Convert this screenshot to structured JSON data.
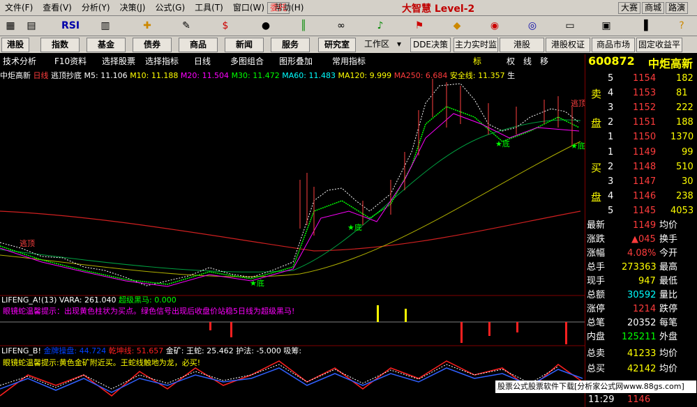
{
  "menu": {
    "items": [
      "文件(F)",
      "查看(V)",
      "分析(Y)",
      "决策(J)",
      "公式(G)",
      "工具(T)",
      "窗口(W)",
      "帮助(H)"
    ],
    "wt": "委托",
    "logo": "大智慧 Level-2",
    "dasai": "大赛",
    "shangcheng": "商城",
    "lubiao": "路演"
  },
  "toolbar": {
    "rsi": "RSI"
  },
  "nav": {
    "items": [
      "港股",
      "指数",
      "基金",
      "债券",
      "商品",
      "新闻",
      "服务",
      "研究室"
    ],
    "workzone": "工作区",
    "dde": "DDE决策",
    "tools": [
      "主力实时监",
      "港股",
      "港股权证",
      "商品市场",
      "固定收益平"
    ]
  },
  "subbar": {
    "items": [
      "技术分析",
      "F10资料",
      "选择股票",
      "选择指标",
      "日线",
      "多图组合",
      "图形叠加",
      "常用指标"
    ],
    "biao": "标",
    "quan": "权",
    "xian": "线",
    "yi": "移"
  },
  "info": {
    "stock_name": "中炬高新",
    "period": "日线",
    "indicator": "逃顶抄底",
    "ma5": "M5: 11.106",
    "ma10": "M10: 11.188",
    "ma20": "M20: 11.504",
    "ma30": "M30: 11.472",
    "ma60": "MA60: 11.483",
    "ma120": "MA120: 9.999",
    "ma250": "MA250: 6.684",
    "safe": "安全线: 11.357",
    "sheng": "生"
  },
  "chart_labels": {
    "taoding": "逃顶",
    "di": "底"
  },
  "ind1": {
    "name": "LIFENG_A!(13)",
    "vara": "VARA: 261.040",
    "chaoji": "超级黑马: 0.000",
    "tip": "眼镜蛇温馨提示：出现黄色柱状为买点。绿色信号出现后收盘价站稳5日线为超级黑马!"
  },
  "ind2": {
    "name": "LIFENG_B!",
    "jinshen": "金牌操盘:",
    "jinshen_val": "44.724",
    "qiankun": "乾坤线:",
    "qiankun_val": "51.657",
    "jinkuang": "金矿:",
    "wangshe": "王蛇:",
    "wangshe_val": "25.462",
    "hufa": "护法:",
    "hufa_val": "-5.000",
    "xichou": "吸筹:",
    "tip": "眼镜蛇温馨提示:黄色金矿附近买。王蛇线触地为龙，必买!"
  },
  "quote": {
    "code": "600872",
    "name": "中炬高新",
    "sell_label": [
      "卖",
      "盘"
    ],
    "buy_label": [
      "买",
      "盘"
    ],
    "sells": [
      {
        "lv": "5",
        "p": "1154",
        "v": "182"
      },
      {
        "lv": "4",
        "p": "1153",
        "v": "81"
      },
      {
        "lv": "3",
        "p": "1152",
        "v": "222"
      },
      {
        "lv": "2",
        "p": "1151",
        "v": "188"
      },
      {
        "lv": "1",
        "p": "1150",
        "v": "1370"
      }
    ],
    "buys": [
      {
        "lv": "1",
        "p": "1149",
        "v": "99"
      },
      {
        "lv": "2",
        "p": "1148",
        "v": "510"
      },
      {
        "lv": "3",
        "p": "1147",
        "v": "30"
      },
      {
        "lv": "4",
        "p": "1146",
        "v": "238"
      },
      {
        "lv": "5",
        "p": "1145",
        "v": "4053"
      }
    ],
    "stats": [
      {
        "l": "最新",
        "v": "1149",
        "r": "均价"
      },
      {
        "l": "涨跌",
        "v": "▲045",
        "r": "换手"
      },
      {
        "l": "涨幅",
        "v": "4.08%",
        "r": "今开"
      },
      {
        "l": "总手",
        "v": "273363",
        "r": "最高"
      },
      {
        "l": "现手",
        "v": "947",
        "r": "最低"
      },
      {
        "l": "总额",
        "v": "30592",
        "r": "量比"
      },
      {
        "l": "涨停",
        "v": "1214",
        "r": "跌停"
      },
      {
        "l": "总笔",
        "v": "20352",
        "r": "每笔"
      },
      {
        "l": "内盘",
        "v": "125211",
        "r": "外盘"
      },
      {
        "l": "总卖",
        "v": "41233",
        "r": "均价"
      },
      {
        "l": "总买",
        "v": "42142",
        "r": "均价"
      }
    ],
    "time": "11:29",
    "last": "1146"
  },
  "banner": "股票公式股票软件下载[分析家公式网www.88gs.com]"
}
